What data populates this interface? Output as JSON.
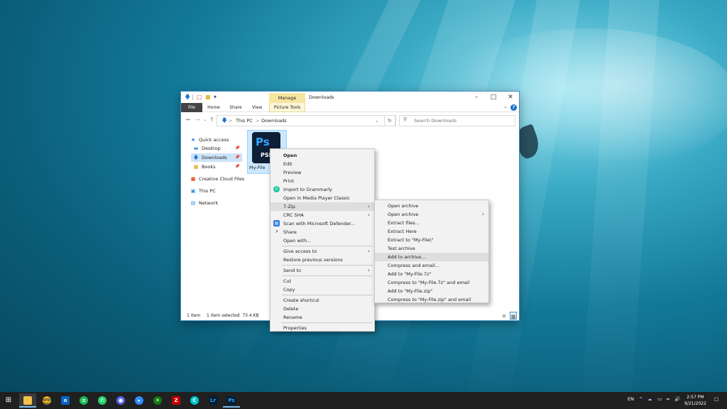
{
  "colors": {
    "accent": "#0078d7",
    "manage_tab": "#f7e6a0",
    "selection": "#cce8ff",
    "menu_bg": "#f2f2f2",
    "taskbar": "#202020"
  },
  "explorer": {
    "title": "Downloads",
    "context_tab": "Manage",
    "ribbon_tabs": [
      "File",
      "Home",
      "Share",
      "View",
      "Picture Tools"
    ],
    "address": {
      "root": "This PC",
      "folder": "Downloads",
      "sep": ">"
    },
    "search_placeholder": "Search Downloads",
    "nav": [
      {
        "label": "Quick access",
        "icon": "star-icon"
      },
      {
        "label": "Desktop",
        "icon": "desktop-folder-icon"
      },
      {
        "label": "Downloads",
        "icon": "download-icon"
      },
      {
        "label": "Books",
        "icon": "folder-icon"
      },
      {
        "label": "Creative Cloud Files",
        "icon": "creative-cloud-icon"
      },
      {
        "label": "This PC",
        "icon": "pc-icon"
      },
      {
        "label": "Network",
        "icon": "network-icon"
      }
    ],
    "file": {
      "name": "My-File",
      "icon_text": "Ps",
      "icon_ext": "PSD"
    },
    "status": {
      "count": "1 item",
      "selected": "1 item selected  73.4 KB"
    }
  },
  "context_menu": {
    "items": [
      "Open",
      "Edit",
      "Preview",
      "Print",
      "Import to Grammarly",
      "Open in Media Player Classic",
      "7-Zip",
      "CRC SHA",
      "Scan with Microsoft Defender...",
      "Share",
      "Open with...",
      "Give access to",
      "Restore previous versions",
      "Send to",
      "Cut",
      "Copy",
      "Create shortcut",
      "Delete",
      "Rename",
      "Properties"
    ]
  },
  "submenu_7zip": {
    "items": [
      "Open archive",
      "Open archive",
      "Extract files...",
      "Extract Here",
      "Extract to \"My-File\\\"",
      "Test archive",
      "Add to archive...",
      "Compress and email...",
      "Add to \"My-File.7z\"",
      "Compress to \"My-File.7z\" and email",
      "Add to \"My-File.zip\"",
      "Compress to \"My-File.zip\" and email"
    ]
  },
  "taskbar": {
    "apps": [
      "windows-start-icon",
      "file-explorer-icon",
      "chrome-icon",
      "outlook-icon",
      "spotify-icon",
      "whatsapp-icon",
      "discord-icon",
      "zoom-icon",
      "xbox-icon",
      "filezilla-icon",
      "canva-icon",
      "lightroom-icon",
      "photoshop-icon"
    ],
    "lang": "EN",
    "time": "2:57 PM",
    "date": "9/21/2022"
  }
}
